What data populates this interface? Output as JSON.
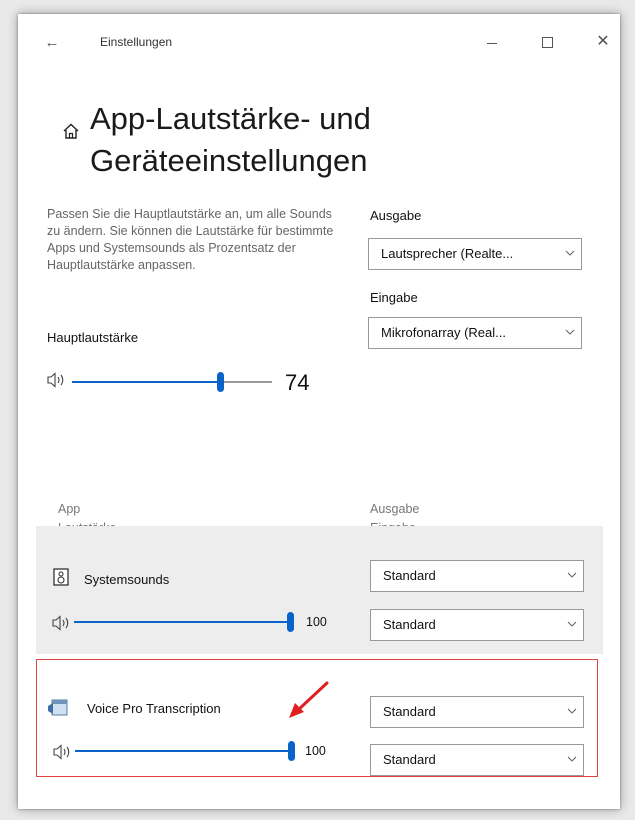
{
  "window": {
    "title": "Einstellungen",
    "back_icon": "arrow-left-icon",
    "controls": [
      "minimize",
      "maximize",
      "close"
    ]
  },
  "page": {
    "title": "App-Lautstärke- und Geräteeinstellungen",
    "home_icon": "home-icon",
    "description": "Passen Sie die Hauptlautstärke an, um alle Sounds zu ändern. Sie können die Lautstärke für bestimmte Apps und Systemsounds als Prozentsatz der Hauptlautstärke anpassen."
  },
  "master": {
    "label": "Hauptlautstärke",
    "value": "74",
    "level_fraction": 0.74
  },
  "devices": {
    "output_label": "Ausgabe",
    "output_value": "Lautsprecher (Realte...",
    "input_label": "Eingabe",
    "input_value": "Mikrofonarray (Real..."
  },
  "app_table": {
    "col_app": "App",
    "col_volume": "Lautstärke",
    "col_output": "Ausgabe",
    "col_input": "Eingabe",
    "rows": [
      {
        "name": "Systemsounds",
        "icon": "speaker-device-icon",
        "value": "100",
        "level_fraction": 1.0,
        "output": "Standard",
        "input": "Standard"
      },
      {
        "name": "Voice Pro Transcription",
        "icon": "app-window-icon",
        "value": "100",
        "level_fraction": 1.0,
        "output": "Standard",
        "input": "Standard",
        "highlighted": true
      }
    ]
  },
  "colors": {
    "accent": "#0a64c8",
    "highlight_border": "#e04545",
    "arrow": "#e02020",
    "selected_row_bg": "#ededed"
  }
}
